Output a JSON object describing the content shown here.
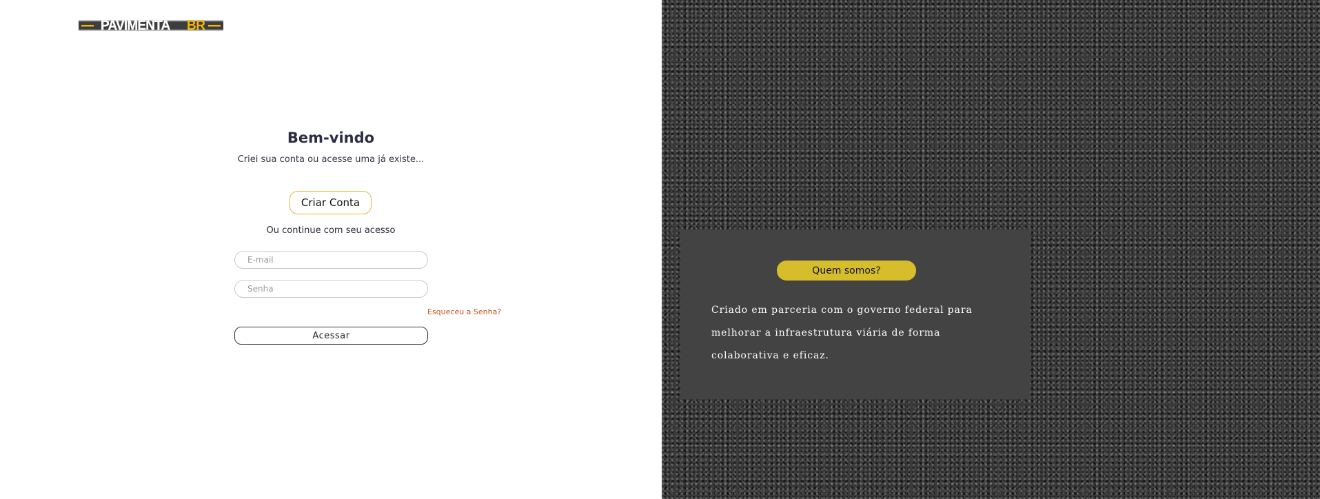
{
  "logo": {
    "text_main": "PAVIMENTA",
    "text_accent": "BR",
    "accent_color": "#f2b705"
  },
  "login": {
    "title": "Bem-vindo",
    "subtitle": "Criei sua conta ou acesse uma já existe...",
    "create_account_label": "Criar Conta",
    "continue_text": "Ou continue com seu acesso",
    "email_placeholder": "E-mail",
    "password_placeholder": "Senha",
    "forgot_password_label": "Esqueceu a Senha?",
    "submit_label": "Acessar"
  },
  "about": {
    "button_label": "Quem somos?",
    "description": "Criado em parceria com o governo federal para melhorar a infraestrutura viária de forma colaborativa e eficaz."
  },
  "colors": {
    "accent_yellow": "#d6bd2c",
    "create_border": "#e2b93b",
    "link_orange": "#c0531f",
    "card_bg": "#434343"
  }
}
